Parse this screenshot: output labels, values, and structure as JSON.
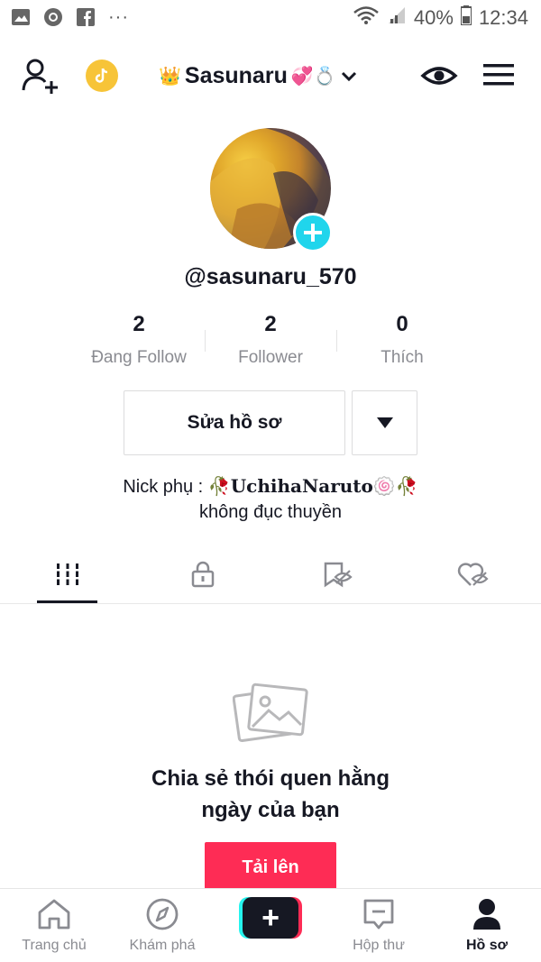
{
  "status_bar": {
    "battery": "40%",
    "time": "12:34",
    "more": "···"
  },
  "header": {
    "title_prefix_emoji": "👑",
    "title": "Sasunaru",
    "title_suffix_emoji": "💞💍"
  },
  "profile": {
    "username": "@sasunaru_570",
    "stats": [
      {
        "value": "2",
        "label": "Đang Follow"
      },
      {
        "value": "2",
        "label": "Follower"
      },
      {
        "value": "0",
        "label": "Thích"
      }
    ],
    "edit_label": "Sửa hồ sơ",
    "bio_prefix": "Nick phụ : ",
    "bio_rose": "🥀",
    "bio_name": "UchihaNaruto",
    "bio_swirl": "🍥",
    "bio_line2": "không đục thuyền"
  },
  "empty_state": {
    "message": "Chia sẻ thói quen hằng ngày của bạn",
    "upload_label": "Tải lên"
  },
  "bottom_nav": {
    "home": "Trang chủ",
    "discover": "Khám phá",
    "create": "+",
    "inbox": "Hộp thư",
    "profile": "Hồ sơ"
  },
  "colors": {
    "accent": "#fe2c55",
    "cyan": "#20d5ec",
    "coin": "#f7c438"
  }
}
